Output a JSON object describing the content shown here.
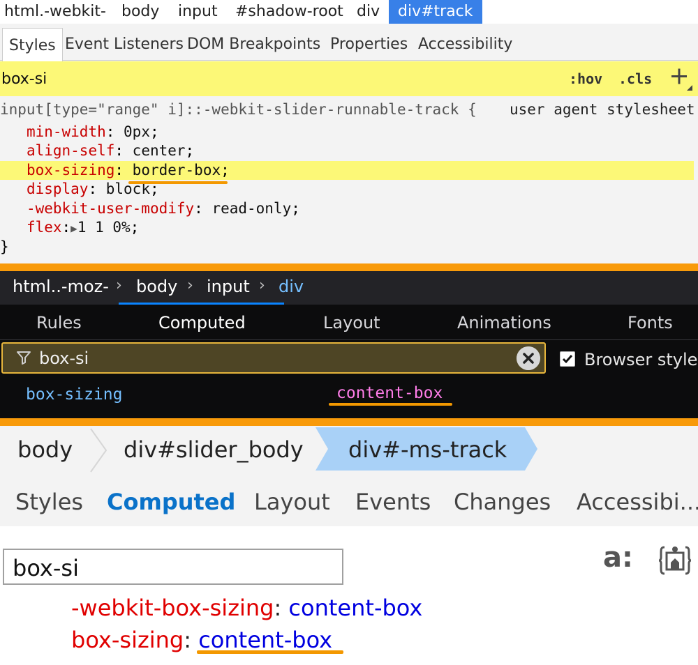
{
  "chrome": {
    "breadcrumbs": [
      "html.-webkit-",
      "body",
      "input",
      "#shadow-root",
      "div",
      "div#track"
    ],
    "tabs": [
      "Styles",
      "Event Listeners",
      "DOM Breakpoints",
      "Properties",
      "Accessibility"
    ],
    "filter_value": "box-si",
    "hov_label": ":hov",
    "cls_label": ".cls",
    "rule": {
      "selector": "input[type=\"range\" i]::-webkit-slider-runnable-track {",
      "source": "user agent stylesheet",
      "declarations": [
        {
          "prop": "min-width",
          "value": "0px"
        },
        {
          "prop": "align-self",
          "value": "center"
        },
        {
          "prop": "box-sizing",
          "value": "border-box"
        },
        {
          "prop": "display",
          "value": "block"
        },
        {
          "prop": "-webkit-user-modify",
          "value": "read-only"
        },
        {
          "prop": "flex",
          "value": "1 1 0%"
        }
      ],
      "close": "}"
    }
  },
  "firefox": {
    "breadcrumbs": [
      "html..-moz-",
      "body",
      "input",
      "div"
    ],
    "tabs": [
      "Rules",
      "Computed",
      "Layout",
      "Animations",
      "Fonts"
    ],
    "filter_value": "box-si",
    "browser_styles_label": "Browser styles",
    "browser_styles_checked": true,
    "computed": {
      "prop": "box-sizing",
      "value": "content-box"
    }
  },
  "edge": {
    "breadcrumbs": [
      "body",
      "div#slider_body",
      "div#-ms-track"
    ],
    "tabs": [
      "Styles",
      "Computed",
      "Layout",
      "Events",
      "Changes",
      "Accessibi..."
    ],
    "search_value": "box-si",
    "a_icon_text": "a:",
    "computed": [
      {
        "prop": "-webkit-box-sizing",
        "value": "content-box"
      },
      {
        "prop": "box-sizing",
        "value": "content-box"
      }
    ]
  },
  "colors": {
    "highlight_orange": "#f39800",
    "separator_orange": "#f89a0a",
    "chrome_filter_yellow": "#fcf877",
    "chrome_crumb_active": "#3880e8",
    "firefox_blue": "#75bfff",
    "firefox_pink": "#ff7de9",
    "edge_active_blue": "#0a72c9",
    "edge_crumb_active": "#a9d1f7"
  },
  "icons": [
    "plus-icon",
    "filter-icon",
    "clear-icon",
    "checkbox-icon",
    "chevron-right-icon",
    "a-colon-icon",
    "brace-element-icon"
  ]
}
